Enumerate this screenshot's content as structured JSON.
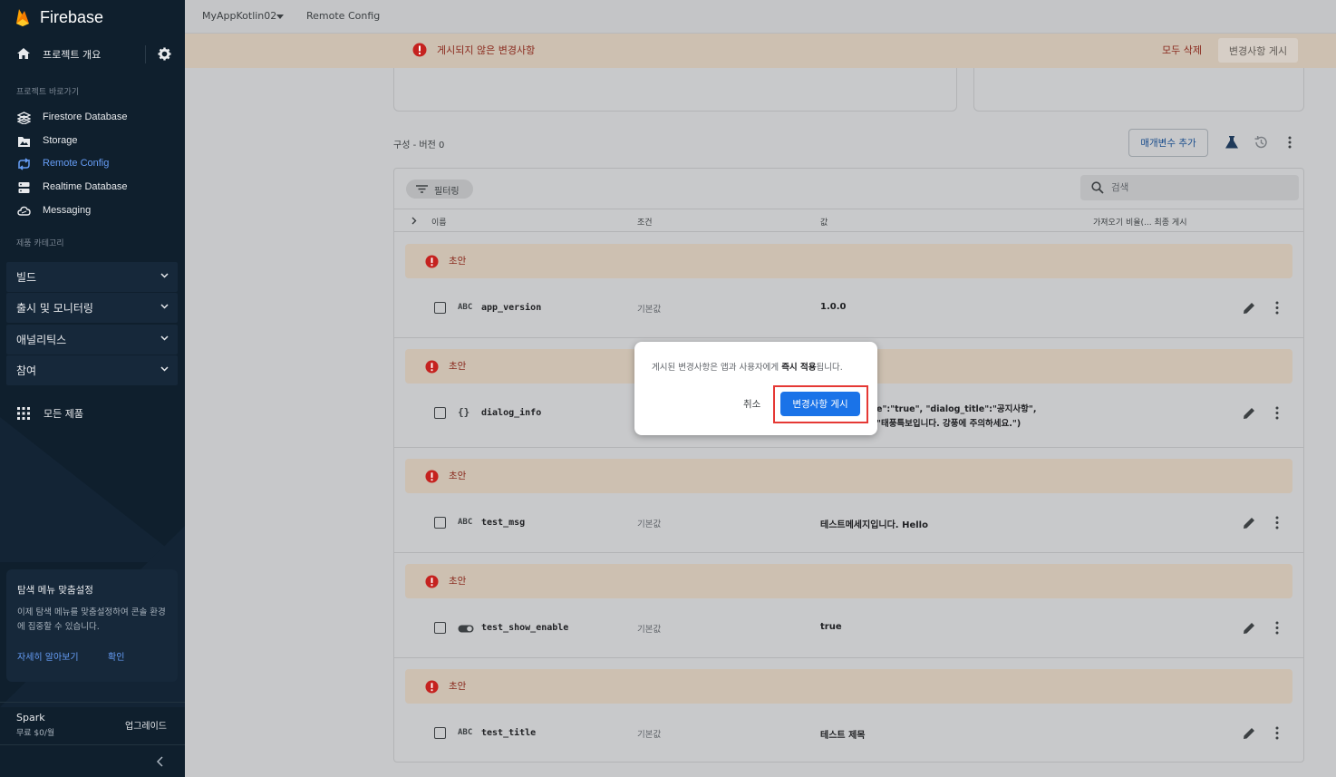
{
  "sidebar": {
    "brand": "Firebase",
    "overview_label": "프로젝트 개요",
    "shortcuts_label": "프로젝트 바로가기",
    "items": [
      {
        "label": "Firestore Database",
        "icon": "firestore-icon"
      },
      {
        "label": "Storage",
        "icon": "storage-icon"
      },
      {
        "label": "Remote Config",
        "icon": "remote-config-icon",
        "active": true
      },
      {
        "label": "Realtime Database",
        "icon": "realtime-database-icon"
      },
      {
        "label": "Messaging",
        "icon": "messaging-icon"
      }
    ],
    "categories_label": "제품 카테고리",
    "categories": [
      {
        "label": "빌드"
      },
      {
        "label": "출시 및 모니터링"
      },
      {
        "label": "애널리틱스"
      },
      {
        "label": "참여"
      }
    ],
    "all_products": "모든 제품",
    "tip": {
      "title": "탐색 메뉴 맞춤설정",
      "desc": "이제 탐색 메뉴를 맞춤설정하여 콘솔 환경에 집중할 수 있습니다.",
      "learn_more": "자세히 알아보기",
      "confirm": "확인"
    },
    "plan": {
      "name": "Spark",
      "price": "무료 $0/월",
      "upgrade": "업그레이드"
    }
  },
  "topbar": {
    "project": "MyAppKotlin02",
    "page": "Remote Config"
  },
  "banner": {
    "text": "게시되지 않은 변경사항",
    "delete_all": "모두 삭제",
    "publish": "변경사항 게시"
  },
  "config": {
    "version": "구성 - 버전 0",
    "add_param": "매개변수 추가"
  },
  "table": {
    "filter": "필터링",
    "search_placeholder": "검색",
    "columns": {
      "name": "이름",
      "condition": "조건",
      "value": "값",
      "fetch": "가져오기 비율(... 최종 게시"
    },
    "draft_label": "초안",
    "rows": [
      {
        "key": "app_version",
        "type": "ABC",
        "condition": "기본값",
        "value": "1.0.0"
      },
      {
        "key": "dialog_info",
        "type": "{}",
        "condition": "",
        "value": "e\":\"true\", \"dialog_title\":\"공지사항\",",
        "value2": "\"태풍특보입니다. 강풍에 주의하세요.\")"
      },
      {
        "key": "test_msg",
        "type": "ABC",
        "condition": "기본값",
        "value": "테스트메세지입니다. Hello"
      },
      {
        "key": "test_show_enable",
        "type": "toggle",
        "condition": "기본값",
        "value": "true"
      },
      {
        "key": "test_title",
        "type": "ABC",
        "condition": "기본값",
        "value": "테스트 제목"
      }
    ]
  },
  "dialog": {
    "msg_pre": "게시된 변경사항은 앱과 사용자에게 ",
    "msg_bold": "즉시 적용",
    "msg_post": "됩니다.",
    "cancel": "취소",
    "ok": "변경사항 게시"
  },
  "colors": {
    "accent": "#1a73e8",
    "draft_bg": "#cdc0b1",
    "error": "#d93025",
    "sidebar_bg": "#0f1f2d",
    "highlight": "#e53935"
  }
}
